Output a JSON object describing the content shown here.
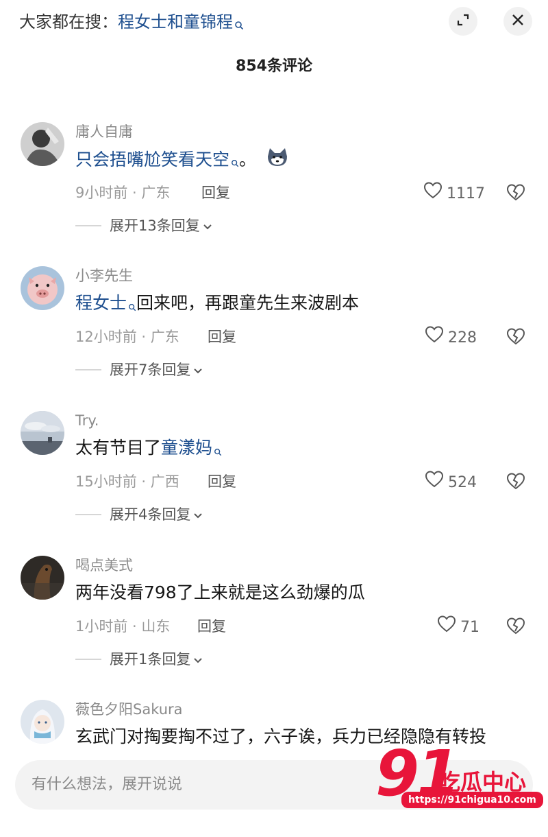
{
  "header": {
    "hint_prefix": "大家都在搜：",
    "hint_keyword": "程女士和童锦程",
    "comment_count": "854条评论"
  },
  "comments": [
    {
      "username": "庸人自庸",
      "text_link": "只会捂嘴尬笑看天空",
      "text_rest": "。",
      "has_emoji": true,
      "time_place": "9小时前 · 广东",
      "reply_label": "回复",
      "likes": "1117",
      "expand_label": "展开13条回复"
    },
    {
      "username": "小李先生",
      "text_link": "程女士",
      "text_rest": "回来吧，再跟童先生来波剧本",
      "time_place": "12小时前 · 广东",
      "reply_label": "回复",
      "likes": "228",
      "expand_label": "展开7条回复"
    },
    {
      "username": "Try.",
      "text_plain": "太有节目了",
      "text_link": "童漾妈",
      "time_place": "15小时前 · 广西",
      "reply_label": "回复",
      "likes": "524",
      "expand_label": "展开4条回复"
    },
    {
      "username": "喝点美式",
      "text_plain": "两年没看798了上来就是这么劲爆的瓜",
      "time_place": "1小时前 · 山东",
      "reply_label": "回复",
      "likes": "71",
      "expand_label": "展开1条回复"
    },
    {
      "username": "薇色夕阳Sakura",
      "text_plain": "玄武门对掏要掏不过了，六子诶，兵力已经隐隐有转投"
    }
  ],
  "input": {
    "placeholder": "有什么想法，展开说说"
  },
  "watermark": {
    "number": "91",
    "name": "吃瓜中心",
    "url": "https://91chigua10.com"
  },
  "colors": {
    "link": "#1e4f8f",
    "watermark": "#e8153a"
  }
}
